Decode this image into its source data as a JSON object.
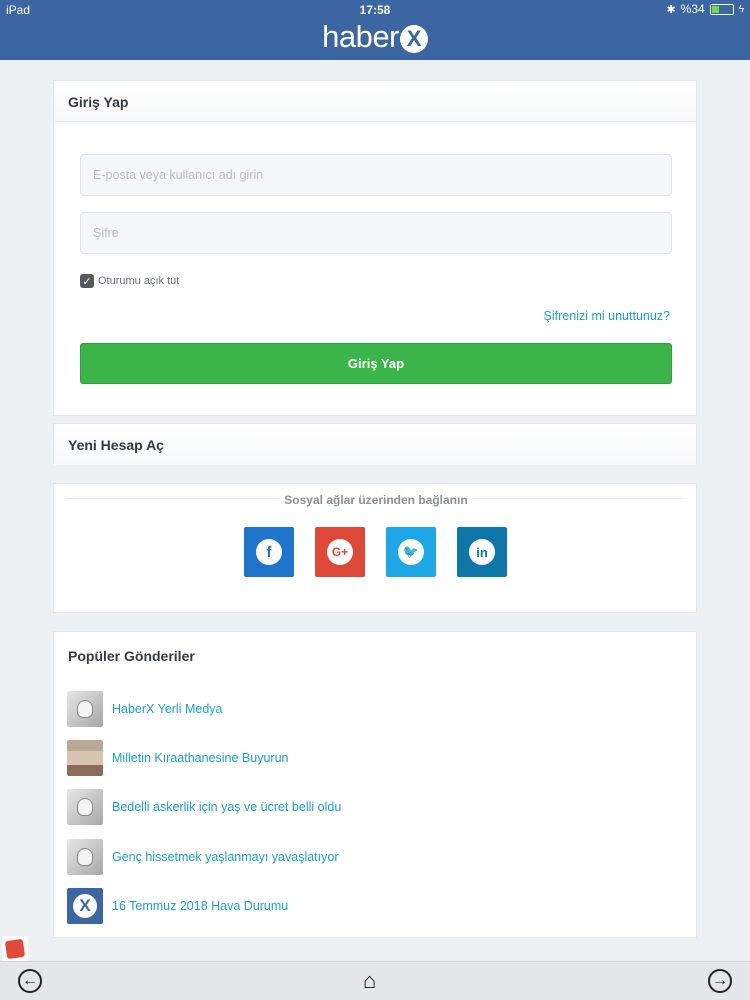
{
  "status_bar": {
    "device": "iPad",
    "time": "17:58",
    "battery": "%34",
    "battery_level": 0.34
  },
  "header": {
    "logo_text": "haber",
    "logo_badge": "X"
  },
  "login": {
    "title": "Giriş Yap",
    "email_placeholder": "E-posta veya kullanıcı adı girin",
    "password_placeholder": "Şifre",
    "remember_label": "Oturumu açık tut",
    "remember_checked": true,
    "forgot_link": "Şifrenizi mi unuttunuz?",
    "submit_label": "Giriş Yap"
  },
  "new_account": {
    "title": "Yeni Hesap Aç"
  },
  "social": {
    "title": "Sosyal ağlar üzerinden bağlanın",
    "buttons": [
      {
        "name": "facebook",
        "glyph": "f",
        "color": "#1e74cd"
      },
      {
        "name": "google-plus",
        "glyph": "G+",
        "color": "#dd4936"
      },
      {
        "name": "twitter",
        "glyph": "🐦",
        "color": "#1ea7e6"
      },
      {
        "name": "linkedin",
        "glyph": "in",
        "color": "#0e76a8"
      }
    ]
  },
  "popular": {
    "title": "Popüler Gönderiler",
    "posts": [
      {
        "title": "HaberX Yerli Medya",
        "thumb": "robot"
      },
      {
        "title": "Milletin Kıraathanesine Buyurun",
        "thumb": "photo"
      },
      {
        "title": "Bedelli askerlik için yaş ve ücret belli oldu",
        "thumb": "robot"
      },
      {
        "title": "Genç hissetmek yaşlanmayı yavaşlatıyor",
        "thumb": "robot"
      },
      {
        "title": "16 Temmuz 2018 Hava Durumu",
        "thumb": "x-logo"
      }
    ]
  },
  "toolbar": {
    "back_icon": "arrow-left-circle-icon",
    "home_icon": "home-icon",
    "forward_icon": "arrow-right-circle-icon"
  },
  "colors": {
    "brand": "#3b66a1",
    "primary_button": "#3bb54a",
    "link": "#1b9ed0"
  }
}
